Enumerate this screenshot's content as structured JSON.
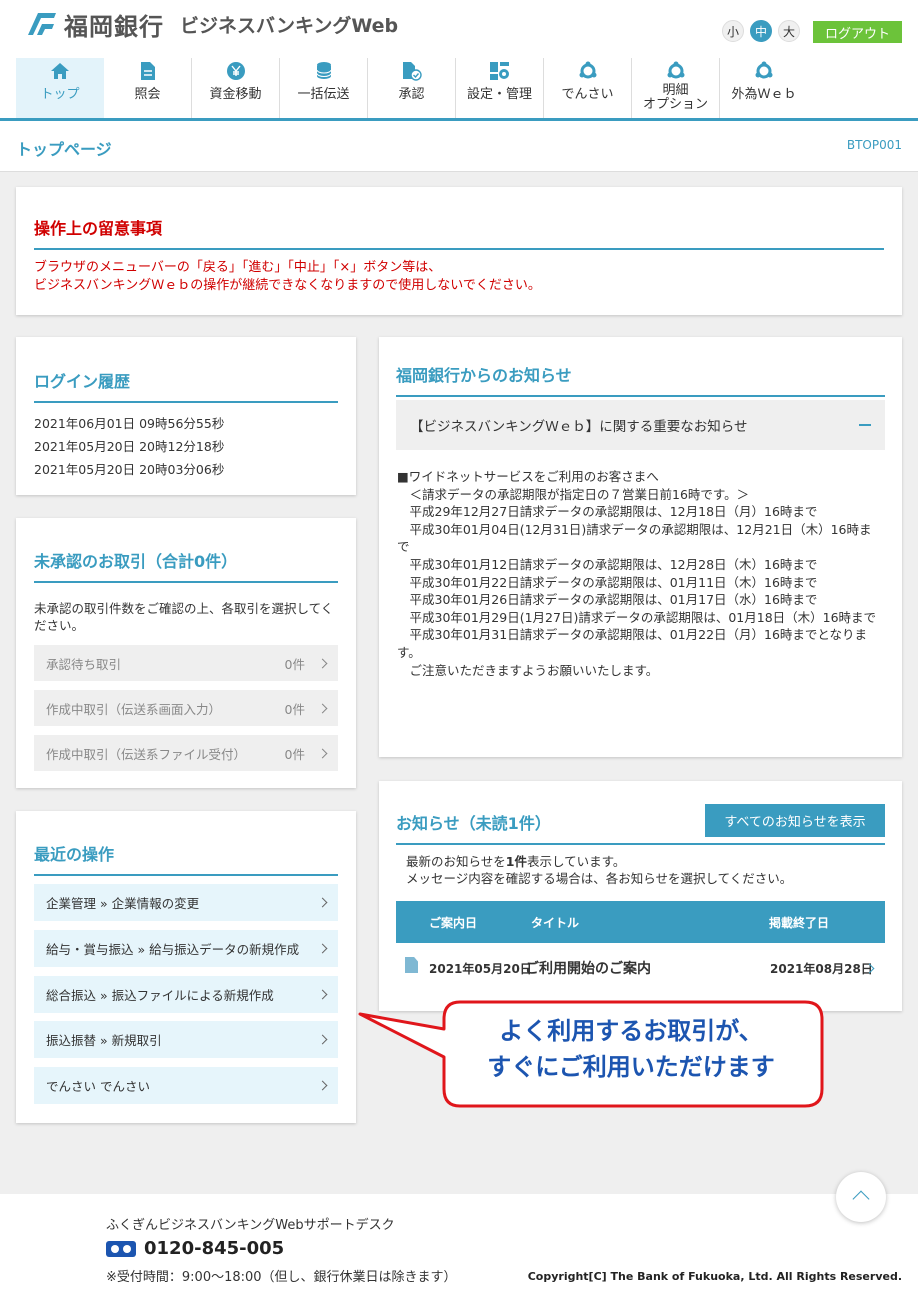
{
  "brand": {
    "bank_name": "福岡銀行",
    "service_name": "ビジネスバンキングWeb"
  },
  "font_size": {
    "small": "小",
    "medium": "中",
    "large": "大",
    "selected": "中"
  },
  "logout_label": "ログアウト",
  "nav": [
    {
      "label": "トップ",
      "icon": "home-icon",
      "active": true
    },
    {
      "label": "照会",
      "icon": "document-icon"
    },
    {
      "label": "資金移動",
      "icon": "yen-transfer-icon"
    },
    {
      "label": "一括伝送",
      "icon": "database-icon"
    },
    {
      "label": "承認",
      "icon": "approval-icon"
    },
    {
      "label": "設定・管理",
      "icon": "settings-icon"
    },
    {
      "label": "でんさい",
      "icon": "densai-icon"
    },
    {
      "label": "明細\nオプション",
      "icon": "statement-icon"
    },
    {
      "label": "外為Ｗｅｂ",
      "icon": "forex-icon"
    }
  ],
  "page": {
    "title": "トップページ",
    "code": "BTOP001"
  },
  "notice": {
    "title": "操作上の留意事項",
    "line1": "ブラウザのメニューバーの「戻る」「進む」「中止」「×」ボタン等は、",
    "line2": "ビジネスバンキングＷｅｂの操作が継続できなくなりますので使用しないでください。"
  },
  "login_history": {
    "title": "ログイン履歴",
    "entries": [
      "2021年06月01日 09時56分55秒",
      "2021年05月20日 20時12分18秒",
      "2021年05月20日 20時03分06秒"
    ]
  },
  "pending": {
    "title": "未承認のお取引（合計0件）",
    "description": "未承認の取引件数をご確認の上、各取引を選択してください。",
    "rows": [
      {
        "label": "承認待ち取引",
        "count": "0件"
      },
      {
        "label": "作成中取引（伝送系画面入力）",
        "count": "0件"
      },
      {
        "label": "作成中取引（伝送系ファイル受付）",
        "count": "0件"
      }
    ]
  },
  "recent": {
    "title": "最近の操作",
    "items": [
      "企業管理 » 企業情報の変更",
      "給与・賞与振込 » 給与振込データの新規作成",
      "総合振込 » 振込ファイルによる新規作成",
      "振込振替 » 新規取引",
      "でんさい でんさい"
    ]
  },
  "bank_news": {
    "title": "福岡銀行からのお知らせ",
    "headline": "【ビジネスバンキングＷｅｂ】に関する重要なお知らせ",
    "lines": [
      "■ワイドネットサービスをご利用のお客さまへ",
      "　＜請求データの承認期限が指定日の７営業日前16時です。＞",
      "　平成29年12月27日請求データの承認期限は、12月18日（月）16時まで",
      "　平成30年01月04日(12月31日)請求データの承認期限は、12月21日（木）16時まで",
      "　平成30年01月12日請求データの承認期限は、12月28日（木）16時まで",
      "　平成30年01月22日請求データの承認期限は、01月11日（木）16時まで",
      "　平成30年01月26日請求データの承認期限は、01月17日（水）16時まで",
      "　平成30年01月29日(1月27日)請求データの承認期限は、01月18日（木）16時まで",
      "　平成30年01月31日請求データの承認期限は、01月22日（月）16時までとなります。",
      "　ご注意いただきますようお願いいたします。"
    ]
  },
  "oshirase": {
    "title": "お知らせ（未読1件）",
    "all_button": "すべてのお知らせを表示",
    "desc_pre": "最新のお知らせを",
    "desc_bold": "1件",
    "desc_post": "表示しています。",
    "desc_line2": "メッセージ内容を確認する場合は、各お知らせを選択してください。",
    "columns": {
      "date": "ご案内日",
      "title": "タイトル",
      "end": "掲載終了日"
    },
    "items": [
      {
        "date": "2021年05月20日",
        "title": "ご利用開始のご案内",
        "end": "2021年08月28日"
      }
    ]
  },
  "callout": {
    "line1": "よく利用するお取引が、",
    "line2": "すぐにご利用いただけます"
  },
  "footer": {
    "desk": "ふくぎんビジネスバンキングWebサポートデスク",
    "phone": "0120-845-005",
    "hours": "※受付時間：9:00～18:00（但し、銀行休業日は除きます）",
    "copyright": "Copyright[C] The Bank of Fukuoka, Ltd. All Rights Reserved."
  },
  "colors": {
    "accent": "#3a9cc0",
    "alert": "#d00000",
    "logout": "#6cc33a",
    "callout_border": "#e0161b",
    "callout_text": "#1c55b0"
  }
}
